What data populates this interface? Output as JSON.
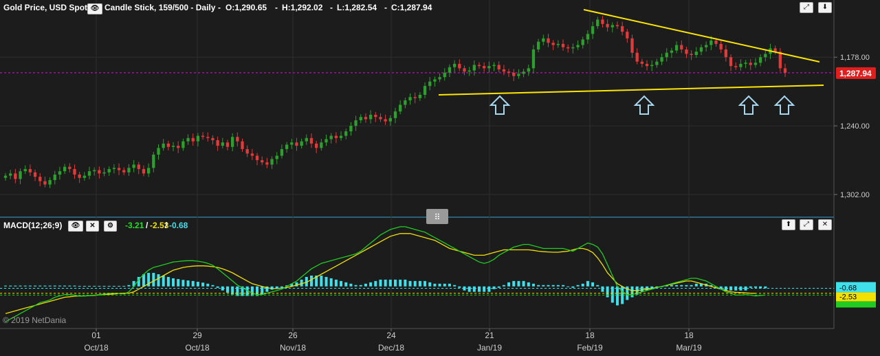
{
  "header": {
    "instrument": "Gold Price, USD Spot",
    "chart_type": "Candle Stick, 159/500 - Daily",
    "open": "O:1,290.65",
    "high": "H:1,292.02",
    "low": "L:1,282.54",
    "close": "C:1,287.94"
  },
  "macd_header": {
    "name": "MACD(12;26;9)",
    "macd_value": "-3.21",
    "signal_value": "-2.53",
    "hist_value": "-0.68",
    "sep1": "/",
    "sep2": "/"
  },
  "price_axis": {
    "ticks": [
      "1,302.00",
      "1,240.00",
      "1,178.00"
    ],
    "last_price": "1,287.94"
  },
  "macd_axis": {
    "hist_label": "-0.68",
    "signal_label": "-2.53"
  },
  "x_axis": {
    "day_ticks": [
      "01",
      "29",
      "26",
      "24",
      "21",
      "18",
      "18"
    ],
    "month_ticks": [
      "Oct/18",
      "Oct/18",
      "Nov/18",
      "Dec/18",
      "Jan/19",
      "Feb/19",
      "Mar/19"
    ]
  },
  "copyright": "© 2019 NetDania",
  "colors": {
    "up": "#2ca02c",
    "down": "#e03a3a",
    "trendline": "#ffe600",
    "macd_line": "#22cc22",
    "signal_line": "#f2e000",
    "histogram": "#3fe0ea",
    "last_price_bg": "#e01e1e",
    "dashed_price": "#c020c0"
  },
  "icons": {
    "eye": "eye-icon",
    "close": "close-icon",
    "gear": "gear-icon",
    "expand": "expand-icon",
    "download": "download-icon",
    "up": "arrow-up-icon"
  },
  "chart_data": [
    {
      "type": "candlestick",
      "title": "Gold Price, USD Spot",
      "ylim": [
        1160,
        1340
      ],
      "y_ticks": [
        1178,
        1240,
        1302
      ],
      "last_price": 1287.94,
      "series": [
        {
          "close": [
            1195,
            1197,
            1192,
            1199,
            1201,
            1198,
            1194,
            1190,
            1187,
            1191,
            1196,
            1199,
            1203,
            1201,
            1196,
            1193,
            1195,
            1199,
            1200,
            1197,
            1198,
            1201,
            1202,
            1200,
            1198,
            1202,
            1205,
            1201,
            1197,
            1202,
            1214,
            1220,
            1224,
            1221,
            1222,
            1220,
            1226,
            1229,
            1226,
            1231,
            1230,
            1229,
            1227,
            1222,
            1225,
            1221,
            1230,
            1226,
            1219,
            1215,
            1213,
            1209,
            1207,
            1205,
            1210,
            1213,
            1219,
            1223,
            1225,
            1222,
            1226,
            1229,
            1224,
            1220,
            1225,
            1228,
            1231,
            1229,
            1231,
            1235,
            1240,
            1245,
            1248,
            1246,
            1250,
            1248,
            1246,
            1244,
            1247,
            1253,
            1259,
            1263,
            1266,
            1265,
            1268,
            1276,
            1280,
            1282,
            1284,
            1288,
            1293,
            1296,
            1292,
            1289,
            1290,
            1295,
            1294,
            1292,
            1294,
            1295,
            1291,
            1289,
            1288,
            1285,
            1287,
            1289,
            1292,
            1309,
            1316,
            1319,
            1315,
            1313,
            1314,
            1311,
            1310,
            1311,
            1313,
            1318,
            1323,
            1330,
            1336,
            1332,
            1329,
            1331,
            1330,
            1325,
            1319,
            1306,
            1298,
            1296,
            1294,
            1295,
            1298,
            1302,
            1306,
            1308,
            1313,
            1309,
            1305,
            1304,
            1307,
            1311,
            1313,
            1317,
            1314,
            1309,
            1302,
            1294,
            1293,
            1296,
            1297,
            1295,
            1297,
            1302,
            1305,
            1310,
            1307,
            1292,
            1288
          ]
        }
      ]
    },
    {
      "type": "line",
      "title": "MACD(12;26;9)",
      "ylim": [
        -14,
        23
      ],
      "series": [
        {
          "name": "MACD",
          "values": [
            -13,
            -12,
            -11,
            -10,
            -9,
            -8,
            -7,
            -6,
            -5.5,
            -5,
            -4,
            -3.5,
            -3,
            -3,
            -3.2,
            -3.6,
            -3.5,
            -3.4,
            -3.2,
            -3,
            -2.8,
            -2.6,
            -2.5,
            -2.6,
            -2.8,
            -2,
            0,
            2.5,
            4.5,
            6,
            7,
            7.5,
            8,
            8.5,
            9,
            9.2,
            9.4,
            9.5,
            9.5,
            9.3,
            9,
            8.5,
            7.8,
            6.5,
            5,
            3.5,
            2,
            0.5,
            -0.5,
            -1.5,
            -2.5,
            -3,
            -3,
            -2.5,
            -2,
            -1.5,
            -1,
            0,
            1,
            2,
            3.5,
            5,
            6.5,
            7.5,
            8.5,
            9,
            9.5,
            10,
            10.5,
            11,
            11.5,
            12,
            13,
            14.5,
            16,
            17.5,
            19,
            20,
            21,
            21.5,
            22,
            22,
            21.5,
            21,
            20.5,
            20,
            19,
            18,
            17,
            16,
            15,
            14,
            13,
            12,
            11,
            10,
            9,
            8.5,
            9,
            10,
            11.5,
            12.5,
            13.5,
            14.5,
            15,
            15.5,
            15.5,
            15,
            14.5,
            14,
            14,
            14,
            14,
            14,
            13.5,
            13,
            14,
            15,
            16,
            15.5,
            14.5,
            12,
            8,
            4,
            0,
            -2,
            -3,
            -3,
            -2.5,
            -2,
            -1.5,
            -1,
            -0.5,
            0,
            0.5,
            1,
            1.5,
            2,
            2.5,
            3,
            3,
            2.5,
            2,
            1,
            0,
            -1,
            -2,
            -2.5,
            -3.2,
            -3.2,
            -3,
            -3.2,
            -3.5,
            -3.3,
            -3.21
          ]
        },
        {
          "name": "Signal",
          "values": [
            -10,
            -9.5,
            -9,
            -8.5,
            -8,
            -7.5,
            -7,
            -6.5,
            -6,
            -5.5,
            -5,
            -4.5,
            -4,
            -3.8,
            -3.6,
            -3.5,
            -3.5,
            -3.4,
            -3.3,
            -3.1,
            -3,
            -2.9,
            -2.8,
            -2.6,
            -2.5,
            -2.5,
            -2,
            -1,
            0,
            1,
            2,
            3,
            4,
            5,
            6,
            6.5,
            7,
            7.3,
            7.5,
            7.6,
            7.6,
            7.5,
            7.3,
            7,
            6.5,
            5.8,
            5,
            4,
            3,
            2,
            1,
            0.5,
            0,
            -0.5,
            -0.8,
            -0.8,
            -0.6,
            -0.4,
            0,
            0.5,
            1,
            1.5,
            2.5,
            3.5,
            4.5,
            5.5,
            6.5,
            7.5,
            8.5,
            9.5,
            10.5,
            11.5,
            12.5,
            13.5,
            14.5,
            15.5,
            16.5,
            17.5,
            18.5,
            19,
            19.5,
            19.5,
            19.5,
            19,
            18.5,
            18,
            17.5,
            17,
            16,
            15,
            14,
            13.5,
            13,
            12.5,
            12,
            11.5,
            11.5,
            11.5,
            12,
            12.5,
            13,
            13.5,
            13.5,
            13.5,
            13.5,
            13.5,
            13.5,
            13.3,
            13,
            12.8,
            12.7,
            12.6,
            12.6,
            12.8,
            13,
            13.5,
            14,
            14,
            13.5,
            12.5,
            10.5,
            8,
            5,
            3,
            1,
            0,
            -1,
            -1.5,
            -1.5,
            -1.3,
            -1,
            -0.7,
            -0.4,
            0,
            0.4,
            0.8,
            1.2,
            1.6,
            2,
            2,
            1.5,
            1,
            0.5,
            0,
            -0.5,
            -1,
            -1.5,
            -2,
            -2.2,
            -2.3,
            -2.4,
            -2.5,
            -2.53
          ]
        },
        {
          "name": "Histogram",
          "values": [
            0.3,
            0.3,
            0.3,
            0.3,
            0.3,
            0.3,
            0.3,
            0.3,
            0.3,
            0.3,
            0.3,
            0.3,
            0.3,
            0.3,
            0.3,
            0.2,
            0.2,
            0.2,
            0.2,
            0.2,
            0.2,
            0.2,
            0.2,
            0.2,
            0.2,
            0.5,
            2,
            3.5,
            4.5,
            5,
            5,
            4.5,
            4,
            3.5,
            3,
            2.7,
            2.4,
            2.2,
            2,
            1.7,
            1.4,
            1,
            0.5,
            -0.5,
            -1.5,
            -2.3,
            -3,
            -3.5,
            -3.5,
            -3.5,
            -3.5,
            -3.5,
            -3,
            -2,
            -1.2,
            -0.7,
            -0.4,
            0.4,
            1,
            1.5,
            2.5,
            3.5,
            4,
            4,
            4,
            3.5,
            3,
            2.5,
            2,
            1.5,
            1,
            0.5,
            0.5,
            1,
            1.5,
            2,
            2.5,
            2.5,
            2.5,
            2.5,
            2.5,
            2.5,
            2,
            2,
            2,
            2,
            1.5,
            1,
            1,
            1,
            1,
            0.5,
            -0.5,
            -1.5,
            -2,
            -2,
            -2,
            -2,
            -2,
            -1,
            -0.5,
            0.5,
            1.5,
            2,
            2,
            2,
            1.5,
            1,
            0.5,
            0.5,
            0.5,
            0.5,
            0.5,
            0.5,
            0,
            -0.5,
            0.5,
            1,
            2,
            1.5,
            0.5,
            -2,
            -4,
            -6,
            -7,
            -6.5,
            -5,
            -4,
            -3,
            -2,
            -1.5,
            -1,
            -0.5,
            0,
            0.5,
            0.5,
            0.5,
            0.5,
            0.5,
            0.5,
            1,
            1,
            1,
            0.5,
            0,
            -1,
            -1.5,
            -1.5,
            -1.5,
            -1.5,
            -1.5,
            -0.5,
            -0.5,
            -0.7,
            -0.68
          ]
        }
      ]
    }
  ]
}
